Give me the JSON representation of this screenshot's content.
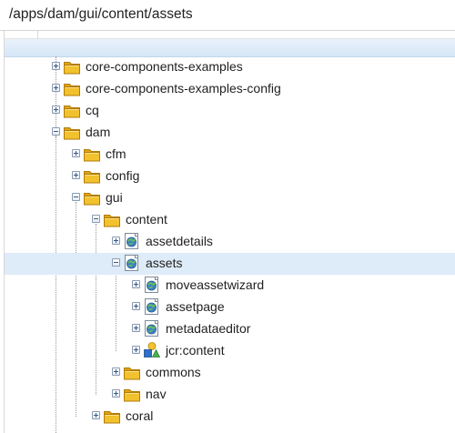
{
  "path_bar": {
    "path": "/apps/dam/gui/content/assets"
  },
  "colors": {
    "folder": "#f2c12e",
    "selected_row": "#deebf8",
    "header": "#d5e6f7"
  },
  "tree": {
    "nodes": [
      {
        "label": "core-components-examples",
        "icon": "folder-icon",
        "expanded": false
      },
      {
        "label": "core-components-examples-config",
        "icon": "folder-icon",
        "expanded": false
      },
      {
        "label": "cq",
        "icon": "folder-icon",
        "expanded": false
      },
      {
        "label": "dam",
        "icon": "folder-icon",
        "expanded": true
      },
      {
        "label": "cfm",
        "icon": "folder-icon",
        "expanded": false
      },
      {
        "label": "config",
        "icon": "folder-icon",
        "expanded": false
      },
      {
        "label": "gui",
        "icon": "folder-icon",
        "expanded": true
      },
      {
        "label": "content",
        "icon": "folder-icon",
        "expanded": true
      },
      {
        "label": "assetdetails",
        "icon": "component-node-icon",
        "expanded": false
      },
      {
        "label": "assets",
        "icon": "component-node-icon",
        "expanded": true,
        "selected": true
      },
      {
        "label": "moveassetwizard",
        "icon": "component-node-icon",
        "expanded": false
      },
      {
        "label": "assetpage",
        "icon": "component-node-icon",
        "expanded": false
      },
      {
        "label": "metadataeditor",
        "icon": "component-node-icon",
        "expanded": false
      },
      {
        "label": "jcr:content",
        "icon": "jcr-content-node-icon",
        "expanded": false
      },
      {
        "label": "commons",
        "icon": "folder-icon",
        "expanded": false
      },
      {
        "label": "nav",
        "icon": "folder-icon",
        "expanded": false
      },
      {
        "label": "coral",
        "icon": "folder-icon",
        "expanded": false
      }
    ]
  }
}
